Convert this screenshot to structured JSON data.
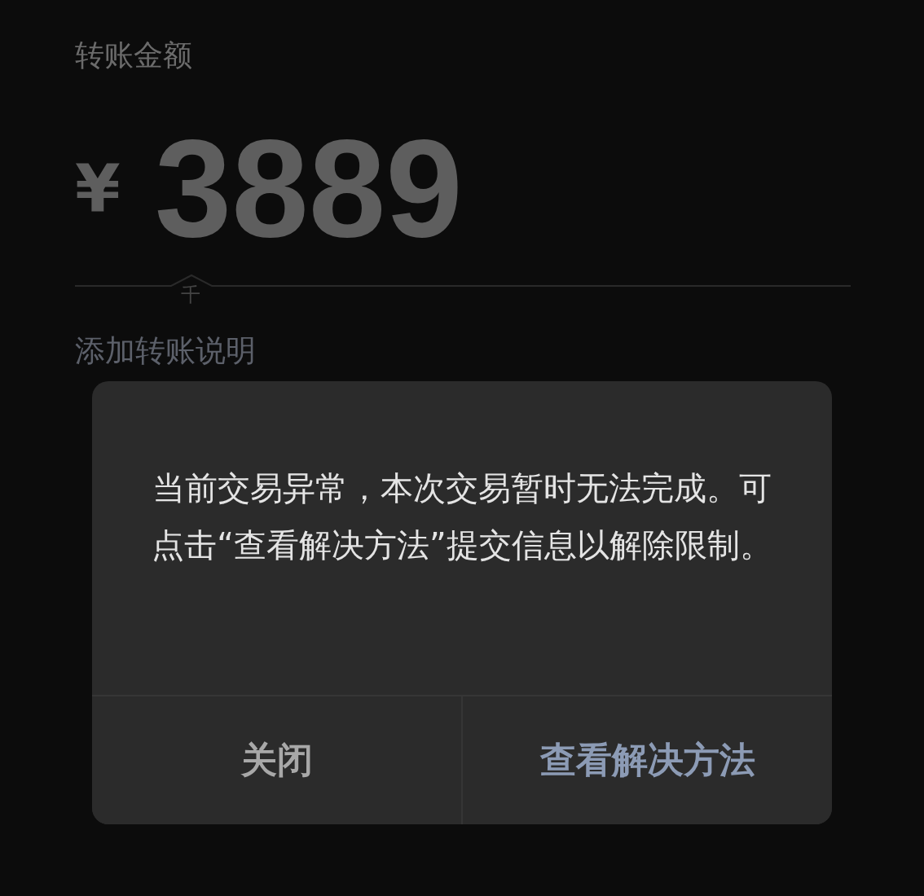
{
  "transfer": {
    "label": "转账金额",
    "currency": "¥",
    "amount": "3889",
    "unit_hint": "千",
    "note_link": "添加转账说明"
  },
  "dialog": {
    "message": "当前交易异常，本次交易暂时无法完成。可点击“查看解决方法”提交信息以解除限制。",
    "buttons": [
      {
        "label": "关闭",
        "kind": "dismiss"
      },
      {
        "label": "查看解决方法",
        "kind": "primary"
      }
    ]
  }
}
